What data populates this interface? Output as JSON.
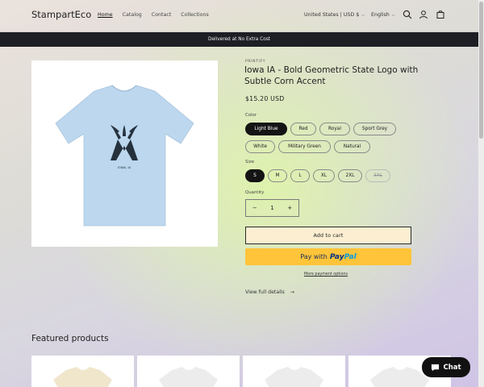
{
  "header": {
    "logo": "StampartEco",
    "nav": [
      {
        "label": "Home",
        "active": true
      },
      {
        "label": "Catalog",
        "active": false
      },
      {
        "label": "Contact",
        "active": false
      },
      {
        "label": "Collections",
        "active": false
      }
    ],
    "currency": "United States | USD $",
    "language": "English",
    "icons": [
      "search-icon",
      "account-icon",
      "cart-icon"
    ]
  },
  "announcement": "Delivered at No Extra Cost",
  "product": {
    "vendor": "PRINTIFY",
    "title": "Iowa IA - Bold Geometric State Logo with Subtle Corn Accent",
    "price": "$15.20 USD",
    "image_caption": "IOWA, IA",
    "color_label": "Color",
    "colors": [
      {
        "label": "Light Blue",
        "selected": true
      },
      {
        "label": "Red",
        "selected": false
      },
      {
        "label": "Royal",
        "selected": false
      },
      {
        "label": "Sport Grey",
        "selected": false
      },
      {
        "label": "White",
        "selected": false
      },
      {
        "label": "Military Green",
        "selected": false
      },
      {
        "label": "Natural",
        "selected": false
      }
    ],
    "size_label": "Size",
    "sizes": [
      {
        "label": "S",
        "selected": true,
        "sold_out": false
      },
      {
        "label": "M",
        "selected": false,
        "sold_out": false
      },
      {
        "label": "L",
        "selected": false,
        "sold_out": false
      },
      {
        "label": "XL",
        "selected": false,
        "sold_out": false
      },
      {
        "label": "2XL",
        "selected": false,
        "sold_out": false
      },
      {
        "label": "3XL",
        "selected": false,
        "sold_out": true
      }
    ],
    "quantity_label": "Quantity",
    "quantity": "1",
    "add_to_cart": "Add to cart",
    "paypal_prefix": "Pay with",
    "paypal_brand_1": "Pay",
    "paypal_brand_2": "Pal",
    "more_payment": "More payment options",
    "view_full": "View full details"
  },
  "featured": {
    "heading": "Featured products",
    "card_colors": [
      "#efe6cc",
      "#eeeeee",
      "#eeeeee",
      "#eeeeee"
    ]
  },
  "chat": {
    "label": "Chat"
  },
  "colors": {
    "announcement_bg": "#1d1f24",
    "shirt_blue": "#bcd7ee",
    "paypal_yellow": "#ffc439",
    "cart_button_bg": "#fbeed1"
  }
}
